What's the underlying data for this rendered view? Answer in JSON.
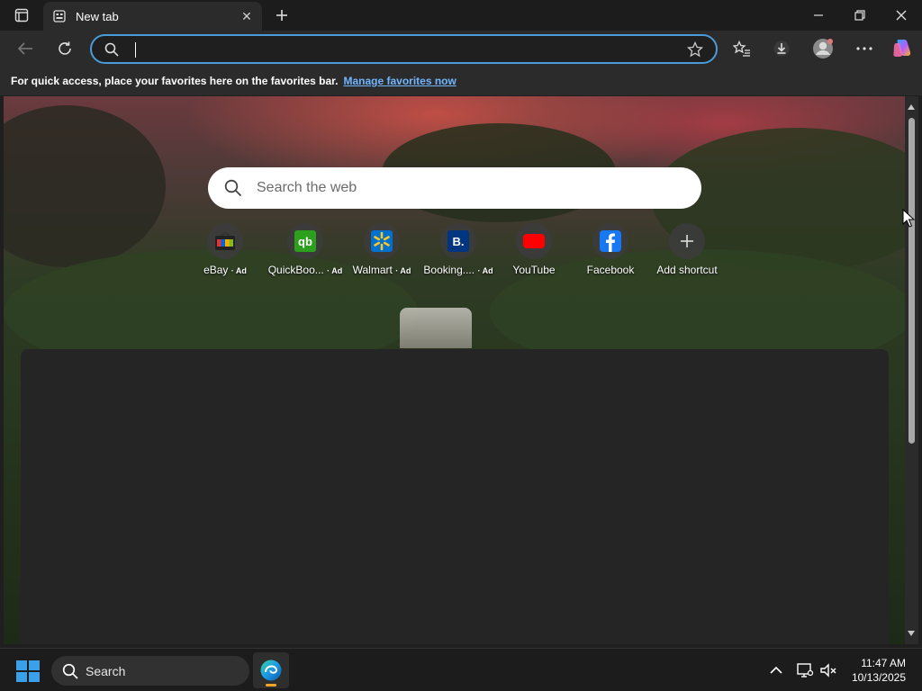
{
  "browser": {
    "tab": {
      "title": "New tab"
    },
    "address_bar": {
      "value": "",
      "placeholder": ""
    }
  },
  "favorites_bar": {
    "message": "For quick access, place your favorites here on the favorites bar.",
    "link": "Manage favorites now"
  },
  "new_tab_page": {
    "search_placeholder": "Search the web",
    "shortcuts": [
      {
        "label": "eBay",
        "ad": "· Ad",
        "icon": "ebay-icon"
      },
      {
        "label": "QuickBoo...",
        "ad": "· Ad",
        "icon": "quickbooks-icon"
      },
      {
        "label": "Walmart",
        "ad": "· Ad",
        "icon": "walmart-icon"
      },
      {
        "label": "Booking....",
        "ad": "· Ad",
        "icon": "booking-icon"
      },
      {
        "label": "YouTube",
        "ad": "",
        "icon": "youtube-icon"
      },
      {
        "label": "Facebook",
        "ad": "",
        "icon": "facebook-icon"
      },
      {
        "label": "Add shortcut",
        "ad": "",
        "icon": "plus-icon"
      }
    ]
  },
  "taskbar": {
    "search_label": "Search",
    "time": "11:47 AM",
    "date": "10/13/2025"
  },
  "colors": {
    "accent": "#4a9bd8",
    "link": "#72b6ff",
    "taskbar_indicator": "#f5a623"
  }
}
